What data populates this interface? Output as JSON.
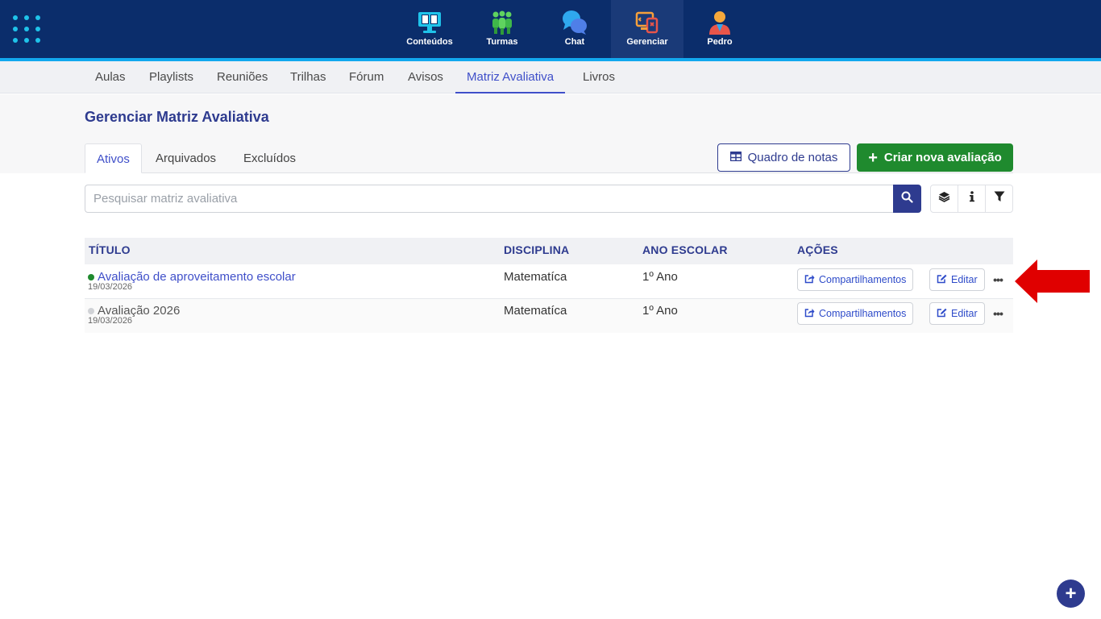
{
  "topnav": {
    "items": [
      {
        "label": "Conteúdos",
        "icon": "monitor-book-icon"
      },
      {
        "label": "Turmas",
        "icon": "people-group-icon"
      },
      {
        "label": "Chat",
        "icon": "chat-bubbles-icon"
      },
      {
        "label": "Gerenciar",
        "icon": "manage-devices-icon",
        "active": true
      },
      {
        "label": "Pedro",
        "icon": "user-avatar-icon"
      }
    ]
  },
  "subnav": {
    "items": [
      "Aulas",
      "Playlists",
      "Reuniões",
      "Trilhas",
      "Fórum",
      "Avisos",
      "Matriz Avaliativa",
      "Livros"
    ],
    "active": "Matriz Avaliativa"
  },
  "page": {
    "title": "Gerenciar Matriz Avaliativa"
  },
  "state_tabs": [
    "Ativos",
    "Arquivados",
    "Excluídos"
  ],
  "toolbar": {
    "quadro_label": "Quadro de notas",
    "criar_label": "Criar nova avaliação"
  },
  "search": {
    "placeholder": "Pesquisar matriz avaliativa",
    "value": ""
  },
  "table": {
    "headers": [
      "TÍTULO",
      "DISCIPLINA",
      "ANO ESCOLAR",
      "AÇÕES"
    ],
    "rows": [
      {
        "title": "Avaliação de aproveitamento escolar",
        "date": "19/03/2026",
        "disciplina": "Matematíca",
        "ano": "1º Ano",
        "status_color": "#1f8a2e"
      },
      {
        "title": "Avaliação 2026",
        "date": "19/03/2026",
        "disciplina": "Matematíca",
        "ano": "1º Ano",
        "status_color": "#d0d2d6"
      }
    ],
    "actions": {
      "share_label": "Compartilhamentos",
      "edit_label": "Editar",
      "more_label": "•••"
    }
  },
  "colors": {
    "topbar": "#0b2d6b",
    "accent": "#12a8ee",
    "primary": "#2e3b8f",
    "link": "#3f4fc9",
    "success": "#1f8a2e",
    "arrow": "#e00000"
  }
}
